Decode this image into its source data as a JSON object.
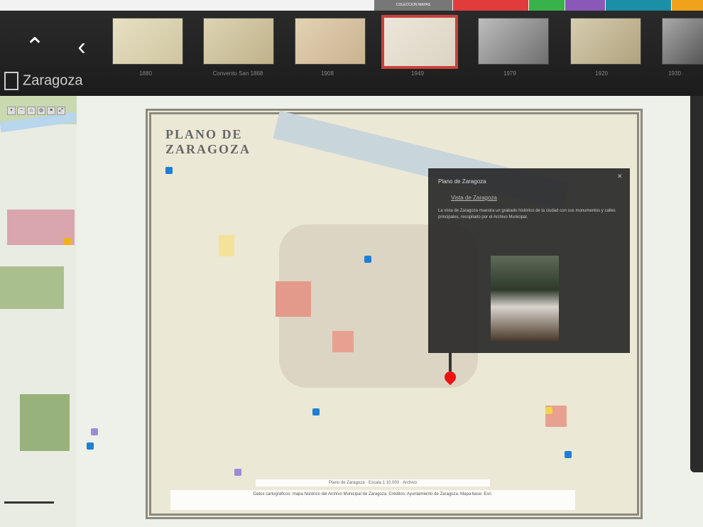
{
  "tabs": [
    {
      "label": "COLECCION MAPAS",
      "color": "#777777"
    },
    {
      "label": "",
      "color": "#e23b3b"
    },
    {
      "label": "",
      "color": "#38b34a"
    },
    {
      "label": "",
      "color": "#8a59b8"
    },
    {
      "label": "",
      "color": "#1b8fa6"
    },
    {
      "label": "",
      "color": "#f0a21b"
    }
  ],
  "header": {
    "title": "Zaragoza",
    "thumbnails": [
      {
        "label": "1880"
      },
      {
        "label": "Convento San 1868"
      },
      {
        "label": "1908"
      },
      {
        "label": "1949"
      },
      {
        "label": "1979"
      },
      {
        "label": "1920"
      },
      {
        "label": "1930"
      }
    ]
  },
  "map": {
    "historic_title": "PLANO DE ZARAGOZA",
    "credits": "Datos cartográficos: mapa histórico del Archivo Municipal de Zaragoza. Créditos: Ayuntamiento de Zaragoza. Mapa base: Esri.",
    "scale_note": "Plano de Zaragoza · Escala 1:10.000 · Archivo"
  },
  "popup": {
    "title": "Plano de Zaragoza",
    "link": "Vista de Zaragoza",
    "body": "La vista de Zaragoza muestra un grabado histórico de la ciudad con sus monumentos y calles principales, recopilado por el Archivo Municipal."
  }
}
